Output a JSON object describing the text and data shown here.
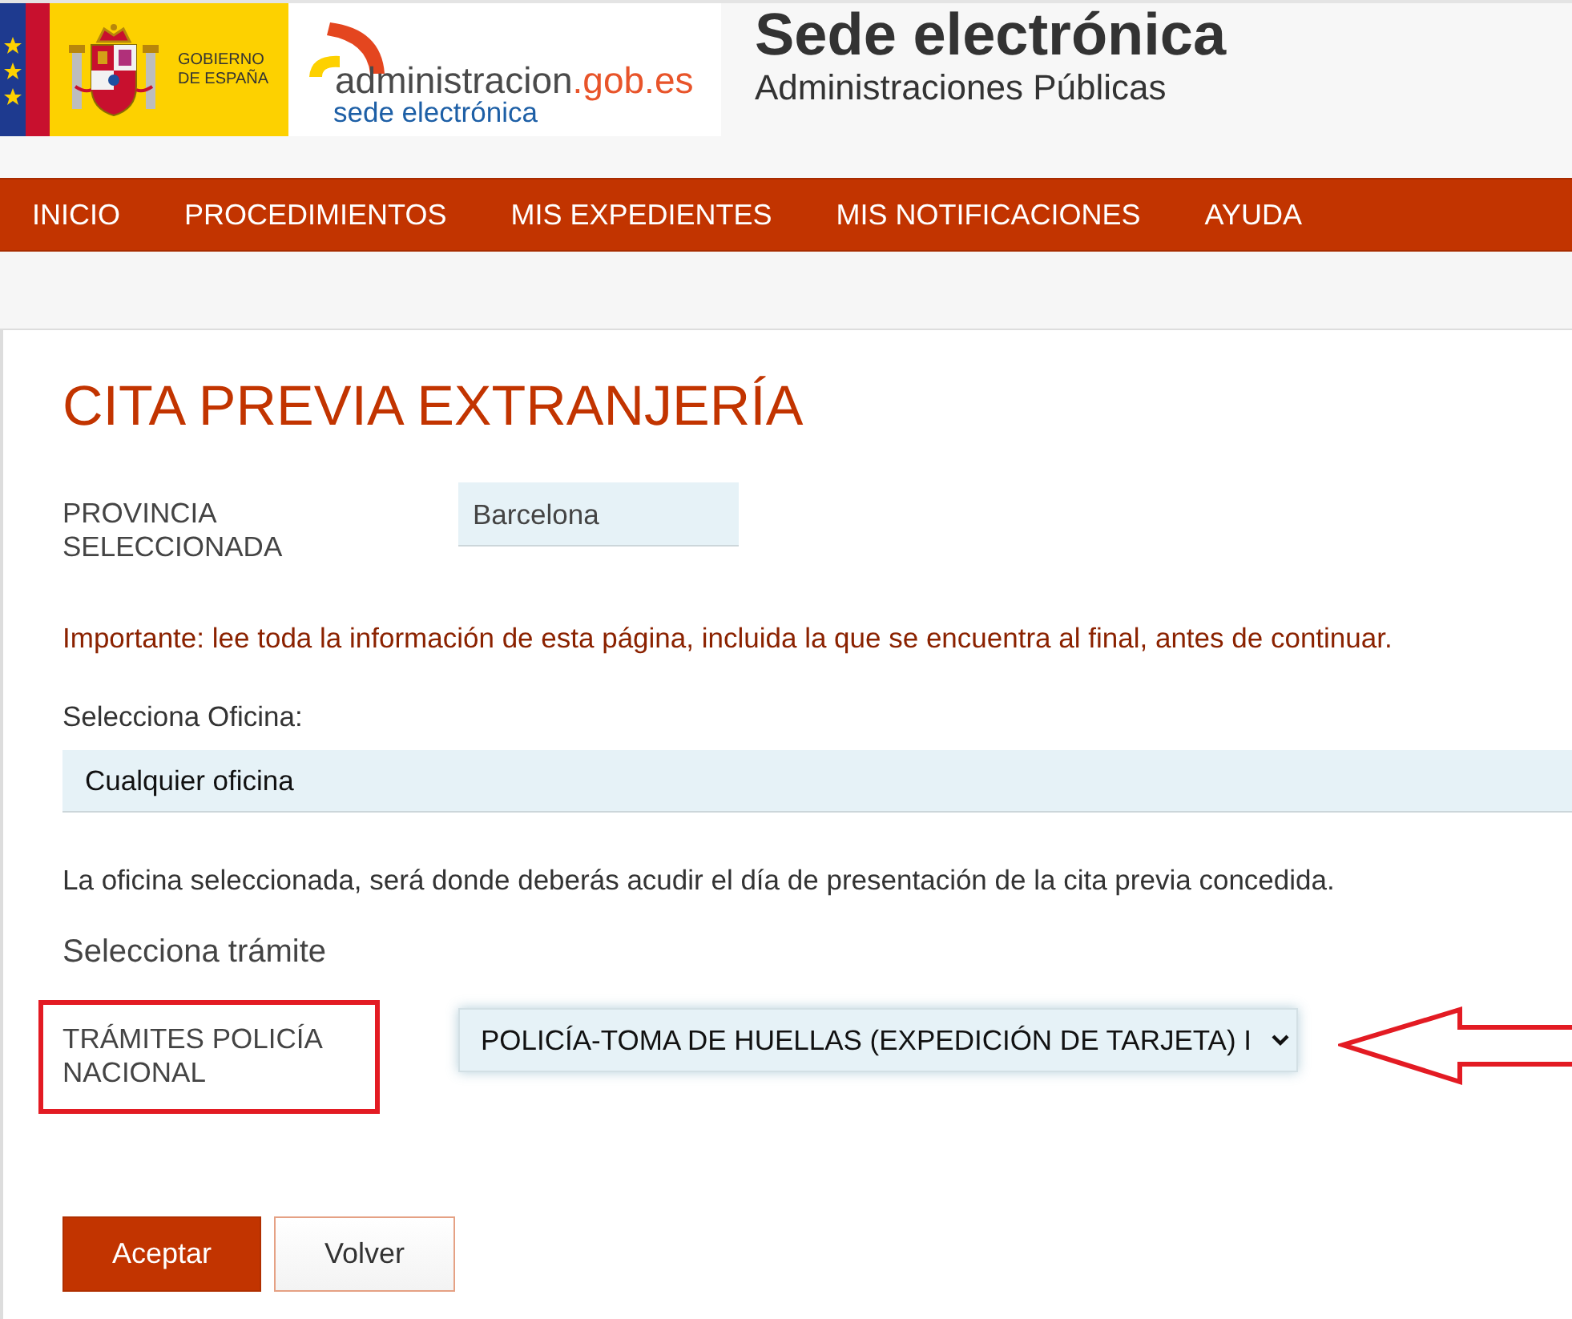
{
  "header": {
    "government_logo": {
      "text": "GOBIERNO DE ESPAÑA"
    },
    "portal_logo": {
      "name": "administracion.gob.es",
      "subtitle": "sede electrónica"
    },
    "title": "Sede electrónica",
    "subtitle": "Administraciones Públicas"
  },
  "nav": [
    {
      "label": "INICIO"
    },
    {
      "label": "PROCEDIMIENTOS"
    },
    {
      "label": "MIS EXPEDIENTES"
    },
    {
      "label": "MIS NOTIFICACIONES"
    },
    {
      "label": "AYUDA"
    }
  ],
  "page": {
    "title": "CITA PREVIA EXTRANJERÍA",
    "province": {
      "label": "PROVINCIA SELECCIONADA",
      "value": "Barcelona"
    },
    "notice": "Importante: lee toda la información de esta página, incluida la que se encuentra al final, antes de continuar.",
    "office": {
      "label": "Selecciona Oficina:",
      "value": "Cualquier oficina"
    },
    "office_hint": "La oficina seleccionada, será donde deberás acudir el día de presentación de la cita previa concedida.",
    "procedure_heading": "Selecciona trámite",
    "procedure": {
      "label": "TRÁMITES POLICÍA NACIONAL",
      "value": "POLICÍA-TOMA DE HUELLAS (EXPEDICIÓN DE TARJETA) I",
      "highlighted": true,
      "pointer_arrow": true
    },
    "buttons": [
      {
        "label": "Aceptar",
        "kind": "primary"
      },
      {
        "label": "Volver",
        "kind": "secondary"
      }
    ]
  }
}
